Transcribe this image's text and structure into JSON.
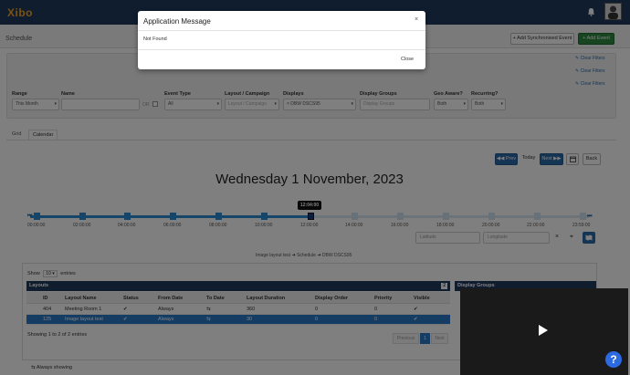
{
  "app": {
    "logo_main": "Xibo",
    "page_title": "Schedule"
  },
  "header": {
    "add_sync_label": "+ Add Synchronised Event",
    "add_event_label": "+ Add Event"
  },
  "filters": {
    "clear_label": "Clear Filters",
    "range_label": "Range",
    "range_value": "This Month",
    "name_label": "Name",
    "name_value": "",
    "or_label": "OR",
    "event_type_label": "Event Type",
    "event_type_value": "All",
    "layout_label": "Layout / Campaign",
    "layout_placeholder": "Layout / Campaign",
    "displays_label": "Displays",
    "displays_value": "× DBW DSCS95",
    "display_groups_label": "Display Groups",
    "display_groups_placeholder": "Display Groups",
    "geo_label": "Geo Aware?",
    "geo_value": "Both",
    "recurring_label": "Recurring?",
    "recurring_value": "Both"
  },
  "tabs": {
    "grid": "Grid",
    "calendar": "Calendar"
  },
  "nav": {
    "prev": "Prev",
    "today": "Today",
    "next": "Next",
    "back": "Back"
  },
  "calendar": {
    "date_heading": "Wednesday 1 November, 2023",
    "current_time": "12:04:00",
    "time_labels": [
      "00:00:00",
      "02:00:00",
      "04:00:00",
      "06:00:00",
      "08:00:00",
      "10:00:00",
      "12:00:00",
      "14:00:00",
      "16:00:00",
      "18:00:00",
      "20:00:00",
      "22:00:00",
      "23:59:00"
    ]
  },
  "geo": {
    "latitude_placeholder": "Latitude",
    "longitude_placeholder": "Longitude"
  },
  "breadcrumb": {
    "layout": "Image layout test",
    "schedule": "Schedule",
    "display": "DBW DSCS95"
  },
  "table": {
    "show_label": "Show",
    "show_value": "10",
    "entries_label": "entries",
    "layouts_title": "Layouts",
    "layouts_count": "2",
    "display_groups_title": "Display Groups",
    "columns": [
      "ID",
      "Layout Name",
      "Status",
      "From Date",
      "To Date",
      "Layout Duration",
      "Display Order",
      "Priority",
      "Visible"
    ],
    "rows": [
      [
        "404",
        "Meeting Room 1",
        "✔",
        "Always",
        "⇆",
        "360",
        "0",
        "0",
        "✔"
      ],
      [
        "125",
        "Image layout test",
        "✔",
        "Always",
        "⇆",
        "30",
        "0",
        "0",
        "✔"
      ]
    ],
    "showing_text": "Showing 1 to 2 of 2 entries",
    "previous": "Previous",
    "page": "1",
    "next": "Next"
  },
  "legend": {
    "always_showing": "Always showing"
  },
  "modal": {
    "title": "Application Message",
    "body": "Not Found",
    "close_label": "Close",
    "x": "×"
  },
  "help": {
    "label": "?"
  }
}
